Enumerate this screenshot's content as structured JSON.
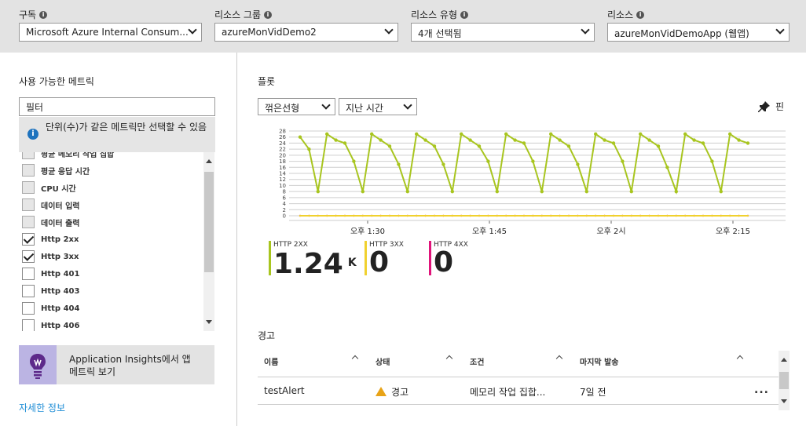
{
  "filters": {
    "subscription": {
      "label": "구독",
      "value": "Microsoft Azure Internal Consum..."
    },
    "resource_group": {
      "label": "리소스 그룹",
      "value": "azureMonVidDemo2"
    },
    "resource_type": {
      "label": "리소스 유형",
      "value": "4개 선택됨"
    },
    "resource": {
      "label": "리소스",
      "value": "azureMonVidDemoApp (웹앱)"
    }
  },
  "metrics_panel": {
    "title": "사용 가능한 메트릭",
    "filter_value": "필터",
    "notice": "단위(수)가 같은 메트릭만 선택할 수 있음",
    "items": [
      {
        "label": "평균 메모리 작업 집합",
        "checked": false,
        "disabled": true
      },
      {
        "label": "평균 응답 시간",
        "checked": false,
        "disabled": true
      },
      {
        "label": "CPU 시간",
        "checked": false,
        "disabled": true
      },
      {
        "label": "데이터 입력",
        "checked": false,
        "disabled": true
      },
      {
        "label": "데이터 출력",
        "checked": false,
        "disabled": true
      },
      {
        "label": "Http 2xx",
        "checked": true,
        "disabled": false
      },
      {
        "label": "Http 3xx",
        "checked": true,
        "disabled": false
      },
      {
        "label": "Http 401",
        "checked": false,
        "disabled": false
      },
      {
        "label": "Http 403",
        "checked": false,
        "disabled": false
      },
      {
        "label": "Http 404",
        "checked": false,
        "disabled": false
      },
      {
        "label": "Http 406",
        "checked": false,
        "disabled": false
      }
    ],
    "app_insights": "Application Insights에서 앱 메트릭 보기",
    "more_info": "자세한 정보"
  },
  "plot": {
    "title": "플롯",
    "chart_type": "꺾은선형",
    "time_range": "지난 시간",
    "pin": "핀"
  },
  "chart_data": {
    "type": "line",
    "x_ticks": [
      "오후 1:30",
      "오후 1:45",
      "오후 2시",
      "오후 2:15"
    ],
    "y_ticks": [
      "0",
      "2",
      "4",
      "6",
      "8",
      "10",
      "12",
      "14",
      "16",
      "18",
      "20",
      "22",
      "24",
      "26",
      "28"
    ],
    "ylim": [
      0,
      28
    ],
    "series": [
      {
        "name": "HTTP 2XX",
        "color": "#a8c51f",
        "values": [
          26,
          22,
          8,
          27,
          25,
          24,
          18,
          8,
          27,
          25,
          23,
          17,
          8,
          27,
          25,
          23,
          17,
          8,
          27,
          25,
          23,
          18,
          8,
          27,
          25,
          24,
          18,
          8,
          27,
          25,
          23,
          17,
          8,
          27,
          25,
          24,
          18,
          8,
          27,
          25,
          23,
          16,
          8,
          27,
          25,
          24,
          18,
          8,
          27,
          25,
          24
        ]
      },
      {
        "name": "HTTP 3XX",
        "color": "#f0d12f",
        "values": [
          0,
          0,
          0,
          0,
          0,
          0,
          0,
          0,
          0,
          0,
          0,
          0,
          0,
          0,
          0,
          0,
          0,
          0,
          0,
          0,
          0,
          0,
          0,
          0,
          0,
          0,
          0,
          0,
          0,
          0,
          0,
          0,
          0,
          0,
          0,
          0,
          0,
          0,
          0,
          0,
          0,
          0,
          0,
          0,
          0,
          0,
          0,
          0,
          0,
          0,
          0
        ]
      },
      {
        "name": "HTTP 4XX",
        "color": "#e0147a",
        "values": [
          0,
          0,
          0,
          0,
          0,
          0,
          0,
          0,
          0,
          0,
          0,
          0,
          0,
          0,
          0,
          0,
          0,
          0,
          0,
          0,
          0,
          0,
          0,
          0,
          0,
          0,
          0,
          0,
          0,
          0,
          0,
          0,
          0,
          0,
          0,
          0,
          0,
          0,
          0,
          0,
          0,
          0,
          0,
          0,
          0,
          0,
          0,
          0,
          0,
          0,
          0
        ]
      }
    ]
  },
  "legend": [
    {
      "name": "HTTP 2XX",
      "value": "1.24",
      "unit": "K",
      "color": "#a8c51f"
    },
    {
      "name": "HTTP 3XX",
      "value": "0",
      "unit": "",
      "color": "#f0d12f"
    },
    {
      "name": "HTTP 4XX",
      "value": "0",
      "unit": "",
      "color": "#e0147a"
    }
  ],
  "alerts": {
    "title": "경고",
    "columns": [
      "이름",
      "상태",
      "조건",
      "마지막 발송"
    ],
    "rows": [
      {
        "name": "testAlert",
        "status": "경고",
        "condition": "메모리 작업 집합...",
        "last_fired": "7일 전",
        "more": "..."
      }
    ]
  },
  "colors": {
    "accent": "#1e8dd6",
    "warning": "#e8a317",
    "app_insights": "#bbb4e3"
  }
}
